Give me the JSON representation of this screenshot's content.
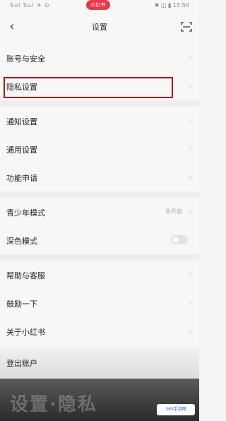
{
  "status": {
    "left": "Sul  Sul  ✈  ⊙",
    "pill": "小红书",
    "right": "✱ ◫ ▮ 15:50"
  },
  "nav": {
    "title": "设置",
    "back_icon": "chevron-left-icon",
    "scan_icon": "scan-icon"
  },
  "rows": {
    "account_security": "账号与安全",
    "privacy": "隐私设置",
    "notifications": "通知设置",
    "general": "通用设置",
    "feature_request": "功能申请",
    "youth_mode": "青少年模式",
    "youth_status": "未开启",
    "dark_mode": "深色模式",
    "help": "帮助与客服",
    "encourage": "鼓励一下",
    "about": "关于小红书"
  },
  "logout": "登出账户",
  "watermark": {
    "text": "设置·隐私",
    "logo": "365手游网"
  }
}
